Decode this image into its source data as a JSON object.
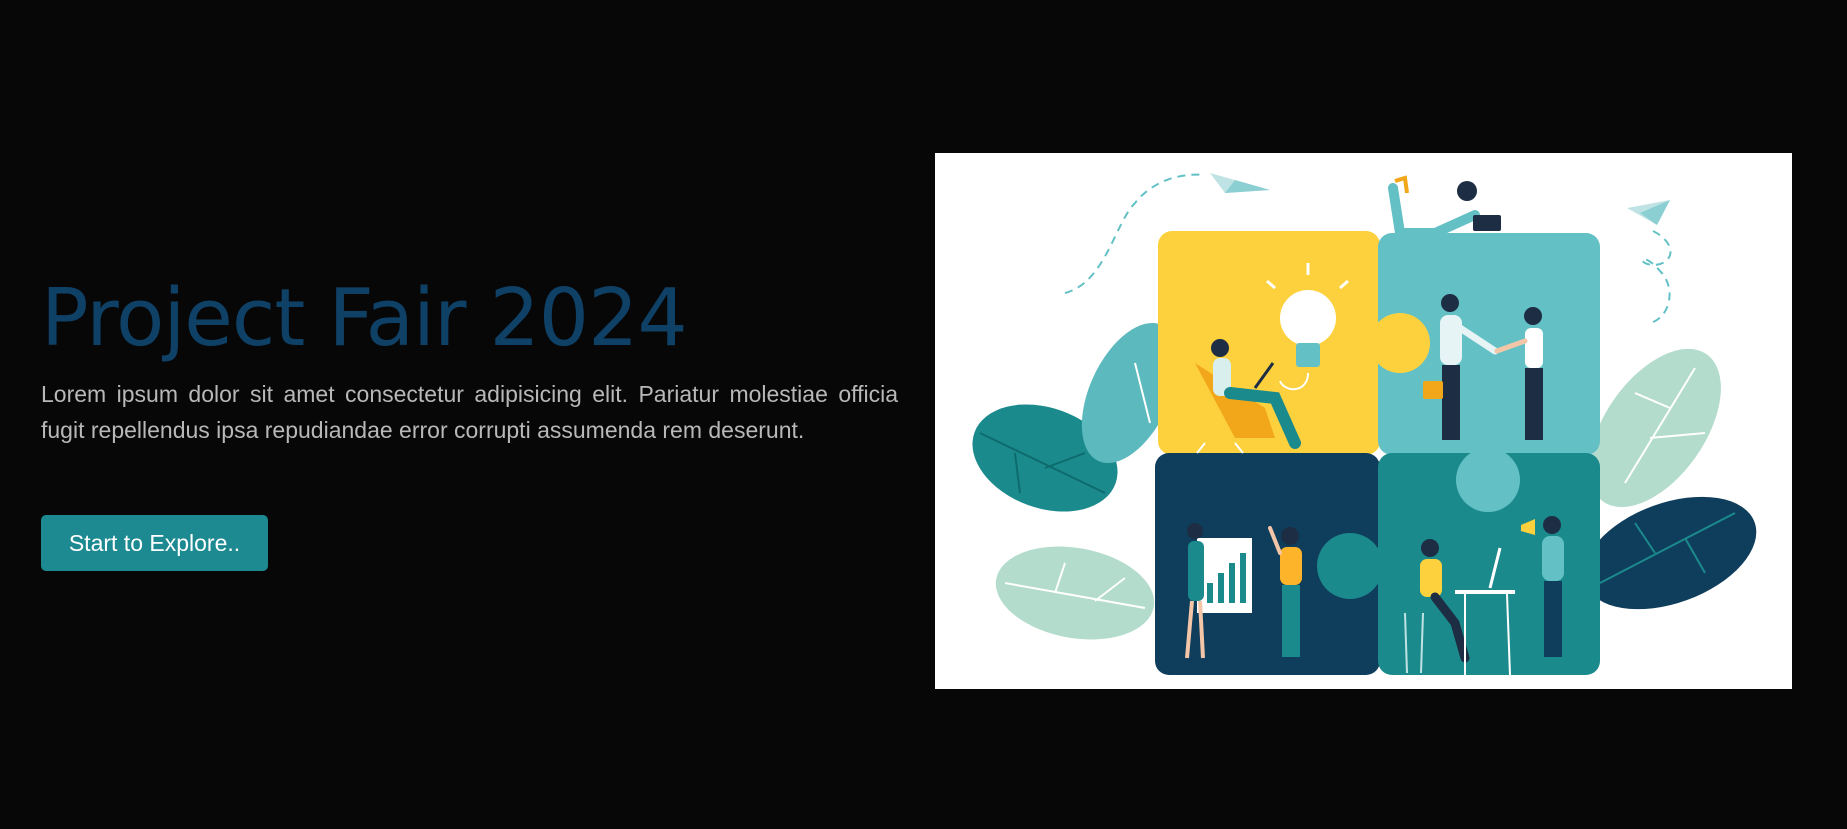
{
  "hero": {
    "title": "Project Fair 2024",
    "description": "Lorem ipsum dolor sit amet consectetur adipisicing elit. Pariatur molestiae officia fugit repellendus ipsa repudiandae error corrupti assumenda rem deserunt.",
    "cta_label": "Start to Explore..",
    "illustration": "teamwork-puzzle-illustration"
  },
  "colors": {
    "background": "#070707",
    "title": "#0f4066",
    "description": "#b8b8b8",
    "button": "#1d8a91",
    "puzzle_yellow": "#fdd13d",
    "puzzle_light_teal": "#63c1c6",
    "puzzle_navy": "#0f3d5c",
    "puzzle_teal": "#1b8a8c"
  }
}
